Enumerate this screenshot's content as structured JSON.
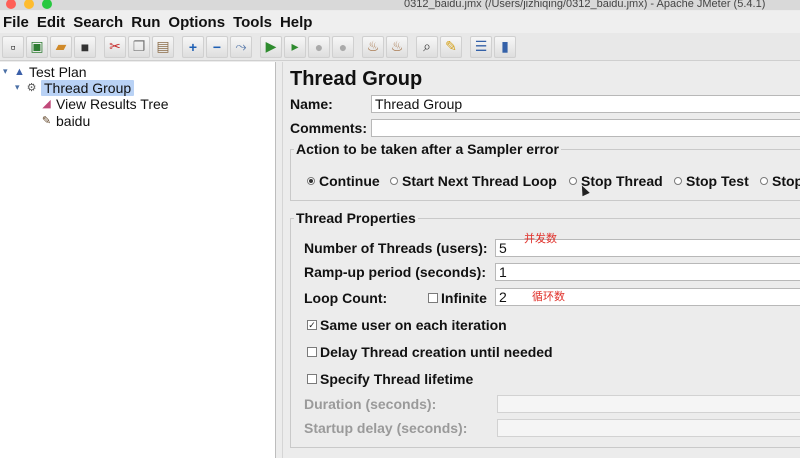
{
  "window": {
    "title": "0312_baidu.jmx (/Users/jizhiqing/0312_baidu.jmx) - Apache JMeter (5.4.1)"
  },
  "menu": [
    "File",
    "Edit",
    "Search",
    "Run",
    "Options",
    "Tools",
    "Help"
  ],
  "toolbar": {
    "icons": [
      "new-icon",
      "templates-icon",
      "open-icon",
      "save-icon",
      "cut-icon",
      "copy-icon",
      "paste-icon",
      "expand-icon",
      "collapse-icon",
      "toggle-icon",
      "start-icon",
      "start-no-pause-icon",
      "stop-icon",
      "shutdown-icon",
      "clear-icon",
      "clear-all-icon",
      "search-icon",
      "reset-search-icon",
      "function-helper-icon",
      "help-icon"
    ]
  },
  "tree": {
    "nodes": [
      {
        "label": "Test Plan",
        "icon": "test-plan-icon",
        "level": 0,
        "expanded": true
      },
      {
        "label": "Thread Group",
        "icon": "thread-group-icon",
        "level": 1,
        "expanded": true,
        "selected": true
      },
      {
        "label": "View Results Tree",
        "icon": "listener-icon",
        "level": 2
      },
      {
        "label": "baidu",
        "icon": "sampler-icon",
        "level": 2
      }
    ]
  },
  "panel": {
    "title": "Thread Group",
    "name_label": "Name:",
    "name_value": "Thread Group",
    "comments_label": "Comments:",
    "comments_value": "",
    "sampler_error": {
      "title": "Action to be taken after a Sampler error",
      "options": [
        "Continue",
        "Start Next Thread Loop",
        "Stop Thread",
        "Stop Test",
        "Stop"
      ],
      "selected": "Continue"
    },
    "thread_props": {
      "title": "Thread Properties",
      "threads_label": "Number of Threads (users):",
      "threads_value": "5",
      "threads_note": "并发数",
      "rampup_label": "Ramp-up period (seconds):",
      "rampup_value": "1",
      "loop_label": "Loop Count:",
      "infinite_label": "Infinite",
      "infinite_checked": false,
      "loop_value": "2",
      "loop_note": "循环数",
      "same_user_label": "Same user on each iteration",
      "same_user_checked": true,
      "delay_label": "Delay Thread creation until needed",
      "delay_checked": false,
      "lifetime_label": "Specify Thread lifetime",
      "lifetime_checked": false,
      "duration_label": "Duration (seconds):",
      "duration_value": "",
      "startup_label": "Startup delay (seconds):",
      "startup_value": ""
    }
  }
}
